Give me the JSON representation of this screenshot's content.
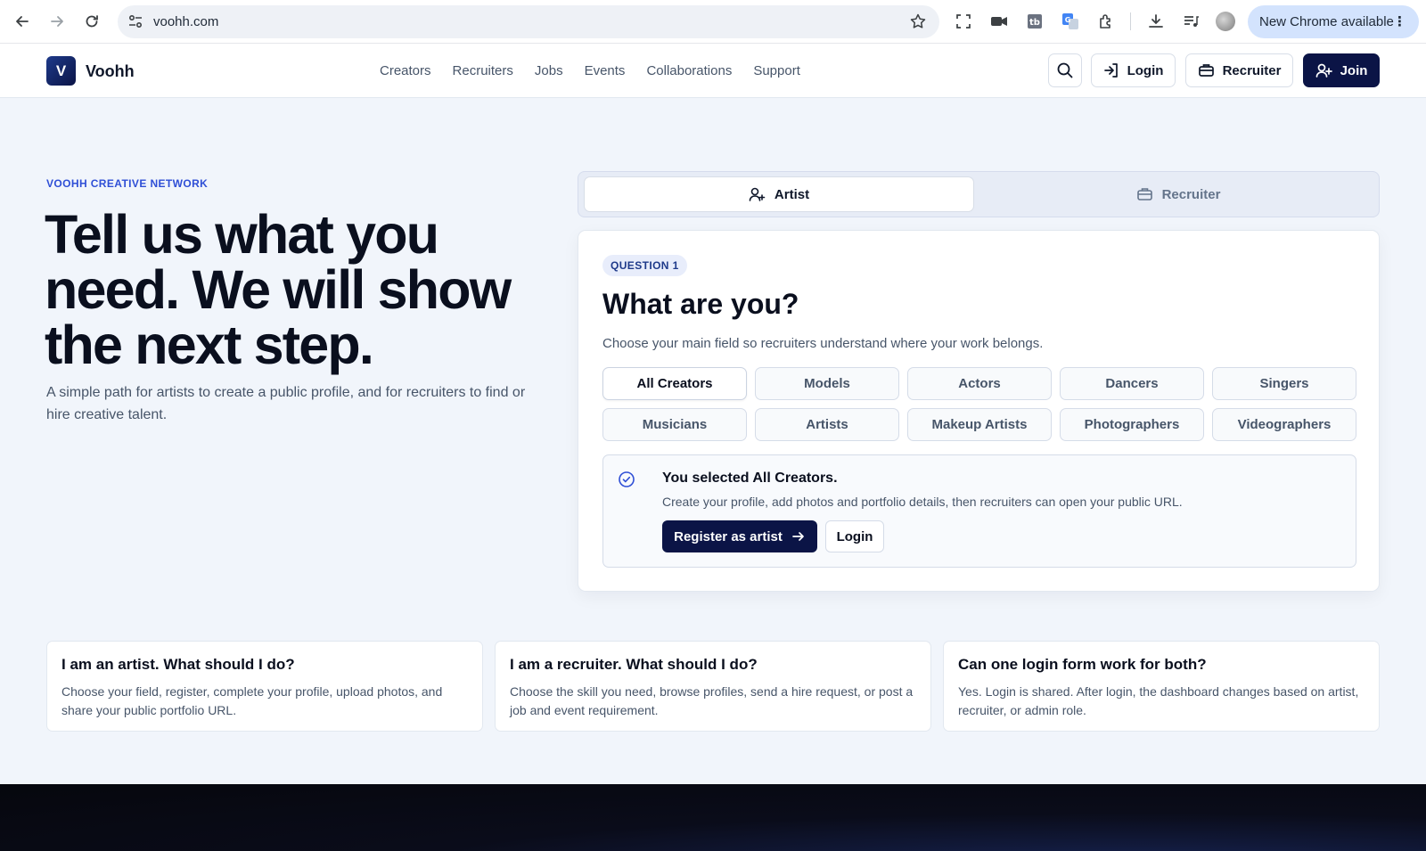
{
  "browser": {
    "url": "voohh.com",
    "update_label": "New Chrome available"
  },
  "header": {
    "logo_letter": "V",
    "brand": "Voohh",
    "nav": [
      "Creators",
      "Recruiters",
      "Jobs",
      "Events",
      "Collaborations",
      "Support"
    ],
    "login_label": "Login",
    "recruiter_label": "Recruiter",
    "join_label": "Join"
  },
  "hero": {
    "eyebrow": "VOOHH CREATIVE NETWORK",
    "title": "Tell us what you need. We will show the next step.",
    "subtitle": "A simple path for artists to create a public profile, and for recruiters to find or hire creative talent."
  },
  "toggle": {
    "artist_label": "Artist",
    "recruiter_label": "Recruiter",
    "active": "Artist"
  },
  "question": {
    "badge": "QUESTION 1",
    "title": "What are you?",
    "subtitle": "Choose your main field so recruiters understand where your work belongs.",
    "options": [
      "All Creators",
      "Models",
      "Actors",
      "Dancers",
      "Singers",
      "Musicians",
      "Artists",
      "Makeup Artists",
      "Photographers",
      "Videographers"
    ],
    "selected": "All Creators",
    "selected_title": "You selected All Creators.",
    "selected_desc": "Create your profile, add photos and portfolio details, then recruiters can open your public URL.",
    "register_label": "Register as artist",
    "login_label": "Login"
  },
  "faq": [
    {
      "q": "I am an artist. What should I do?",
      "a": "Choose your field, register, complete your profile, upload photos, and share your public portfolio URL."
    },
    {
      "q": "I am a recruiter. What should I do?",
      "a": "Choose the skill you need, browse profiles, send a hire request, or post a job and event requirement."
    },
    {
      "q": "Can one login form work for both?",
      "a": "Yes. Login is shared. After login, the dashboard changes based on artist, recruiter, or admin role."
    }
  ],
  "colors": {
    "accent_dark": "#0b1446",
    "eyebrow_blue": "#2f4fd6",
    "page_bg": "#f1f5fb"
  }
}
